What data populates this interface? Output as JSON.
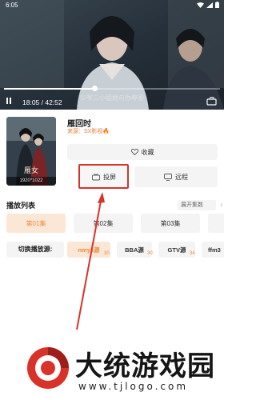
{
  "statusbar": {
    "time": "6:05"
  },
  "player": {
    "subtitle": "少爷三小姐她与你尊贵",
    "time_display": "18:05 / 42:52",
    "progress": 0.42,
    "icons": {
      "pause": "pause-icon",
      "rotate": "rotate-screen-icon"
    }
  },
  "info": {
    "poster_tag": "1920*1022",
    "title": "雁回时",
    "source_label": "来源：SX影视",
    "fav_label": "收藏",
    "cast_label": "投屏",
    "remote_label": "远程",
    "accent": "#f08a3c",
    "highlight_color": "#d8322a"
  },
  "playlist": {
    "title": "播放列表",
    "expand_label": "展开集数",
    "episodes": [
      "第01集",
      "第02集",
      "第03集"
    ],
    "selected_index": 0
  },
  "sources": {
    "title": "切换播放源:",
    "items": [
      {
        "label": "nmys源",
        "count": "30",
        "active": true
      },
      {
        "label": "BBA源",
        "count": "30",
        "active": false
      },
      {
        "label": "GTV源",
        "count": "34",
        "active": false
      },
      {
        "label": "ffm3",
        "count": "",
        "active": false
      }
    ]
  },
  "watermark": {
    "brand": "大统游戏园",
    "url": "www.tjlogo.com"
  }
}
